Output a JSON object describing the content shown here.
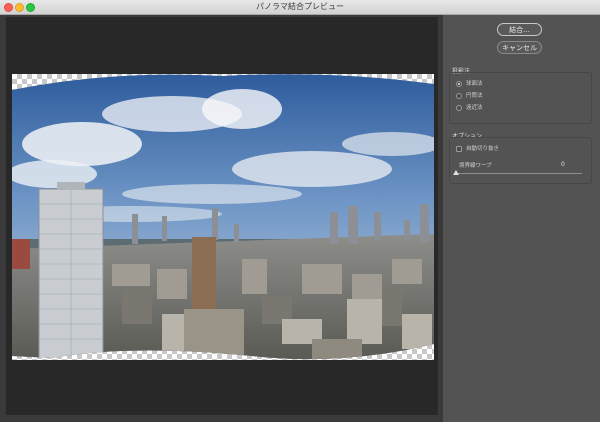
{
  "window": {
    "title": "パノラマ結合プレビュー"
  },
  "buttons": {
    "merge": "結合...",
    "cancel": "キャンセル"
  },
  "projection": {
    "label": "投影法",
    "options": [
      {
        "label": "球面法",
        "selected": true
      },
      {
        "label": "円筒法",
        "selected": false
      },
      {
        "label": "遠近法",
        "selected": false
      }
    ]
  },
  "options": {
    "label": "オプション",
    "auto_crop": {
      "label": "自動切り抜き",
      "checked": false
    },
    "boundary_warp": {
      "label": "境界線ワープ",
      "value": "0"
    }
  },
  "colors": {
    "panel": "#535353",
    "canvas": "#282828",
    "titlebar": "#dcdcdc"
  }
}
